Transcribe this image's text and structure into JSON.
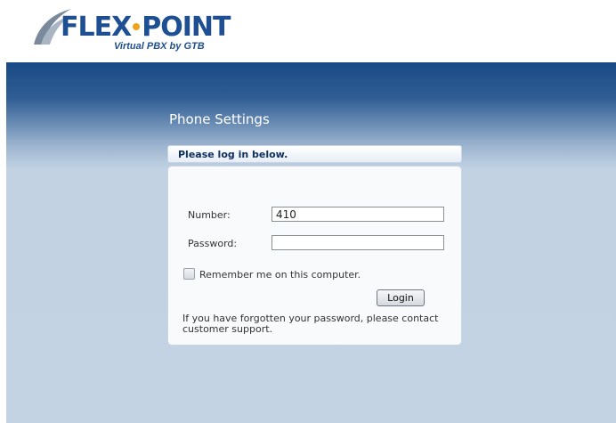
{
  "brand": {
    "logo_part1": "FLEX",
    "logo_part2": "POINT",
    "tagline": "Virtual PBX by GTB",
    "primary_color": "#1f4f93",
    "dot_color": "#f0a21c"
  },
  "page": {
    "title": "Phone Settings"
  },
  "login": {
    "header": "Please log in below.",
    "number_label": "Number:",
    "number_value": "410",
    "password_label": "Password:",
    "password_value": "",
    "remember_label": "Remember me on this computer.",
    "remember_checked": false,
    "login_button": "Login",
    "help_text": "If you have forgotten your password, please contact customer support."
  }
}
